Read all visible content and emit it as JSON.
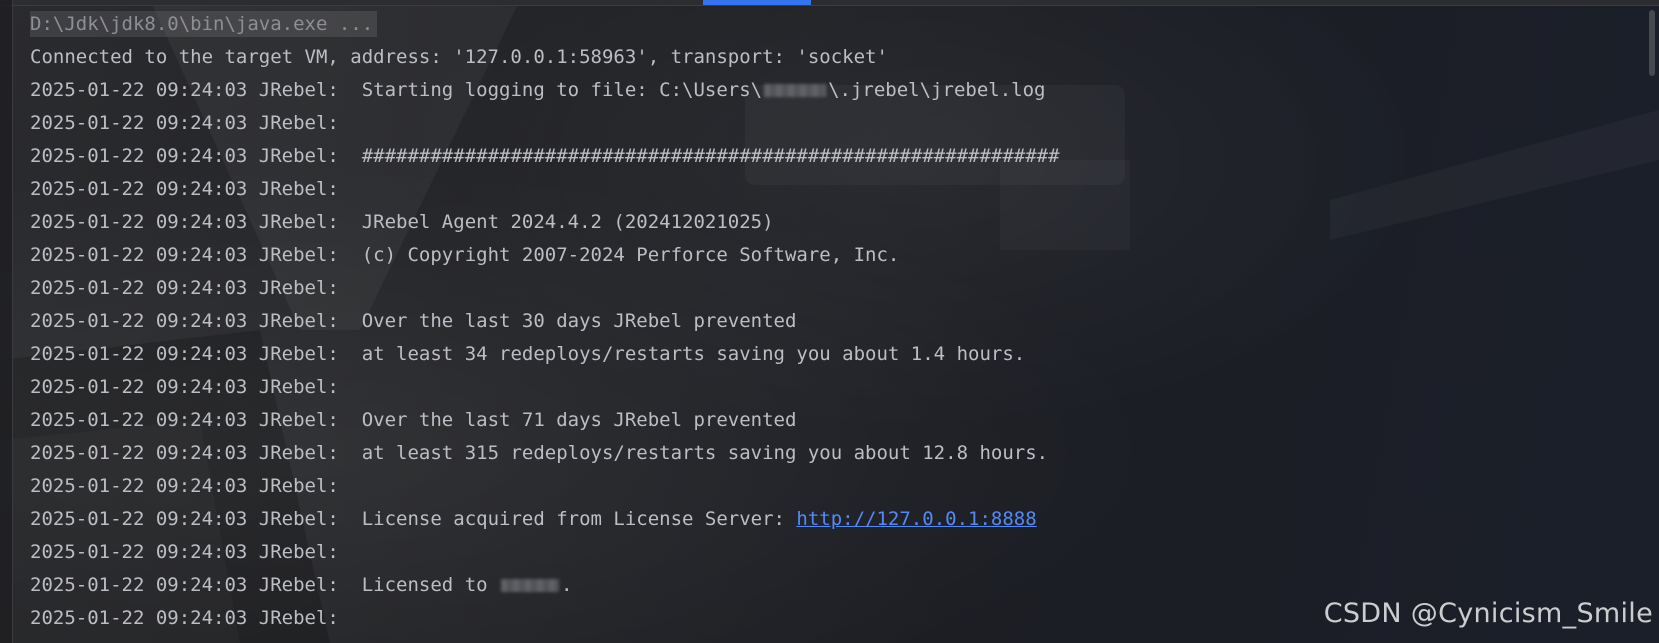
{
  "console": {
    "command": "D:\\Jdk\\jdk8.0\\bin\\java.exe ...",
    "connected": "Connected to the target VM, address: '127.0.0.1:58963', transport: 'socket'",
    "prefix": "2025-01-22 09:24:03 JRebel:",
    "log_path_before": "  Starting logging to file: C:\\Users\\",
    "log_path_after": "\\.jrebel\\jrebel.log",
    "banner": "  #############################################################",
    "agent": "  JRebel Agent 2024.4.2 (202412021025)",
    "copyright": "  (c) Copyright 2007-2024 Perforce Software, Inc.",
    "stat1_a": "  Over the last 30 days JRebel prevented",
    "stat1_b": "  at least 34 redeploys/restarts saving you about 1.4 hours.",
    "stat2_a": "  Over the last 71 days JRebel prevented",
    "stat2_b": "  at least 315 redeploys/restarts saving you about 12.8 hours.",
    "license_text": "  License acquired from License Server: ",
    "license_url": "http://127.0.0.1:8888",
    "licensed_to_before": "  Licensed to ",
    "licensed_to_after": "."
  },
  "watermark": "CSDN @Cynicism_Smile",
  "accent_color": "#3574f0",
  "link_color": "#548af7",
  "text_color": "#bcbec4"
}
